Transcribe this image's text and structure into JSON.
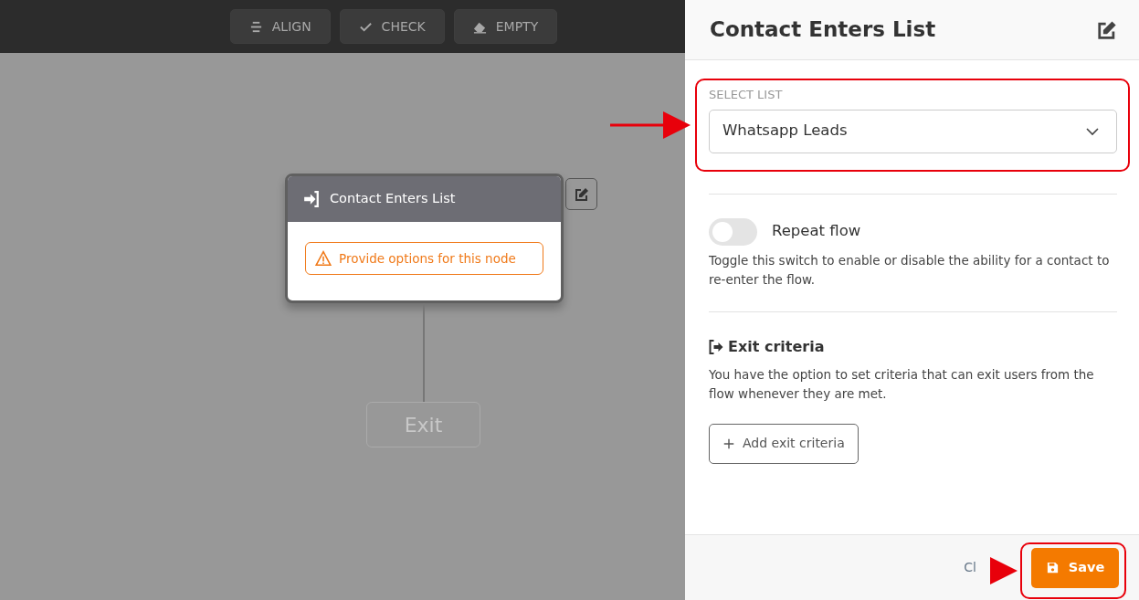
{
  "toolbar": [
    {
      "kind": "align",
      "label": "ALIGN"
    },
    {
      "kind": "check",
      "label": "CHECK"
    },
    {
      "kind": "empty",
      "label": "EMPTY"
    }
  ],
  "node": {
    "title": "Contact Enters List",
    "warning": "Provide options for this node"
  },
  "exit_node": {
    "label": "Exit"
  },
  "panel": {
    "title": "Contact Enters List",
    "select": {
      "label": "SELECT LIST",
      "value": "Whatsapp Leads"
    },
    "repeat": {
      "label": "Repeat flow",
      "on": false,
      "help": "Toggle this switch to enable or disable the ability for a contact to re-enter the flow."
    },
    "exit_criteria": {
      "heading": "Exit criteria",
      "text": "You have the option to set criteria that can exit users from the flow whenever they are met.",
      "button": "Add exit criteria"
    },
    "footer": {
      "close": "Cl",
      "save": "Save"
    }
  }
}
